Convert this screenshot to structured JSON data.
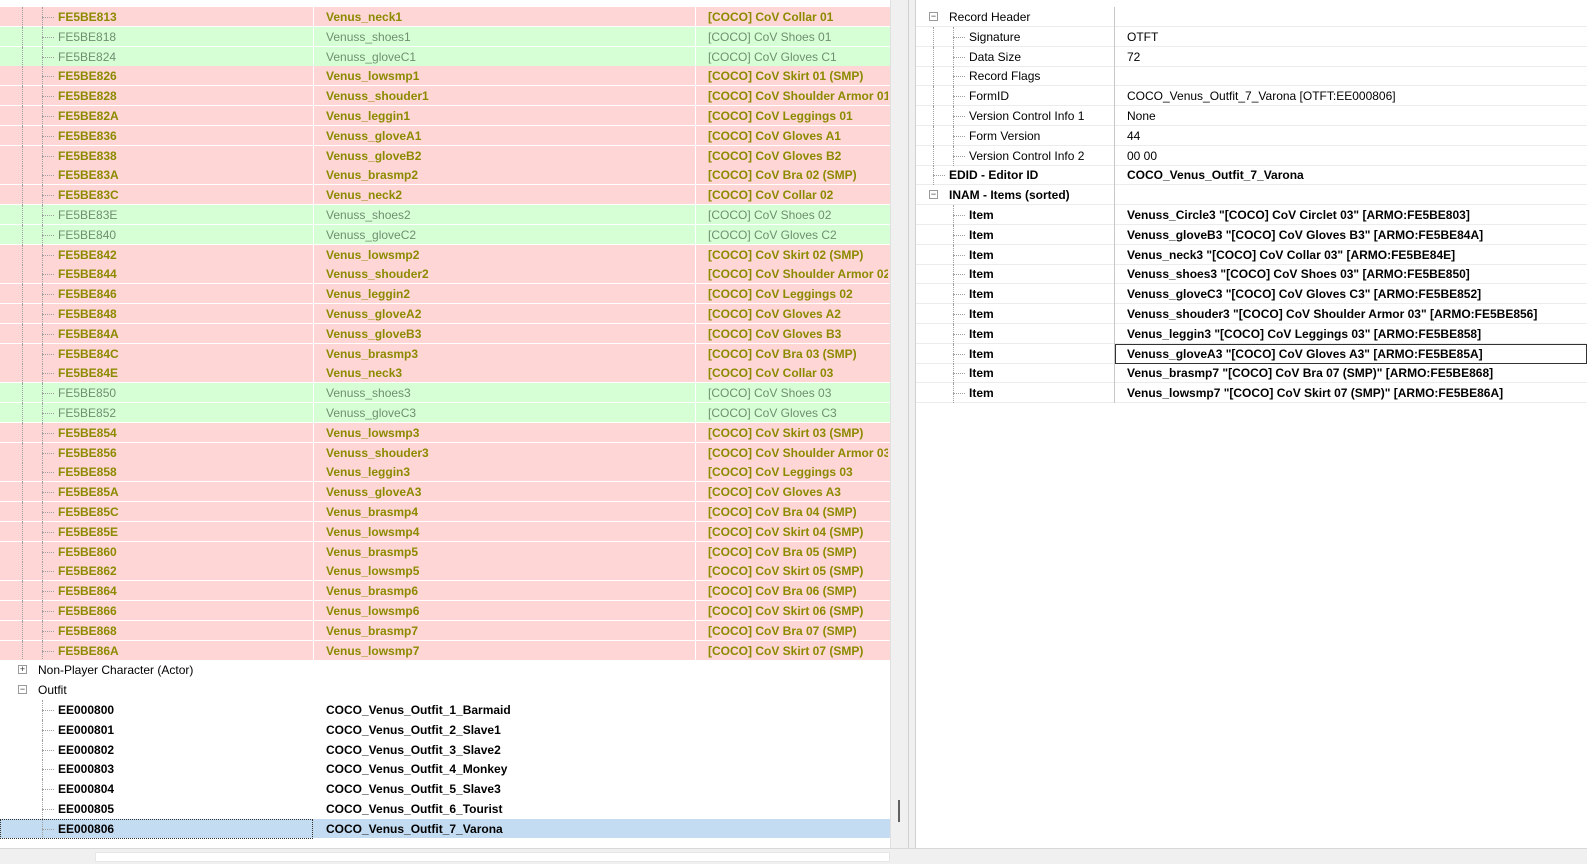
{
  "left_rows": [
    {
      "formid": "FE5BE813",
      "editor_id": "Venus_neck1",
      "name": "[COCO] CoV Collar 01",
      "color": "red"
    },
    {
      "formid": "FE5BE818",
      "editor_id": "Venuss_shoes1",
      "name": "[COCO] CoV Shoes 01",
      "color": "green"
    },
    {
      "formid": "FE5BE824",
      "editor_id": "Venuss_gloveC1",
      "name": "[COCO] CoV Gloves C1",
      "color": "green"
    },
    {
      "formid": "FE5BE826",
      "editor_id": "Venus_lowsmp1",
      "name": "[COCO] CoV Skirt 01 (SMP)",
      "color": "red"
    },
    {
      "formid": "FE5BE828",
      "editor_id": "Venuss_shouder1",
      "name": "[COCO] CoV Shoulder Armor 01",
      "color": "red"
    },
    {
      "formid": "FE5BE82A",
      "editor_id": "Venus_leggin1",
      "name": "[COCO] CoV Leggings 01",
      "color": "red"
    },
    {
      "formid": "FE5BE836",
      "editor_id": "Venuss_gloveA1",
      "name": "[COCO] CoV Gloves A1",
      "color": "red"
    },
    {
      "formid": "FE5BE838",
      "editor_id": "Venuss_gloveB2",
      "name": "[COCO] CoV Gloves B2",
      "color": "red"
    },
    {
      "formid": "FE5BE83A",
      "editor_id": "Venus_brasmp2",
      "name": "[COCO] CoV Bra 02 (SMP)",
      "color": "red"
    },
    {
      "formid": "FE5BE83C",
      "editor_id": "Venus_neck2",
      "name": "[COCO] CoV Collar 02",
      "color": "red"
    },
    {
      "formid": "FE5BE83E",
      "editor_id": "Venuss_shoes2",
      "name": "[COCO] CoV Shoes 02",
      "color": "green"
    },
    {
      "formid": "FE5BE840",
      "editor_id": "Venuss_gloveC2",
      "name": "[COCO] CoV Gloves C2",
      "color": "green"
    },
    {
      "formid": "FE5BE842",
      "editor_id": "Venus_lowsmp2",
      "name": "[COCO] CoV Skirt 02 (SMP)",
      "color": "red"
    },
    {
      "formid": "FE5BE844",
      "editor_id": "Venuss_shouder2",
      "name": "[COCO] CoV Shoulder Armor 02",
      "color": "red"
    },
    {
      "formid": "FE5BE846",
      "editor_id": "Venus_leggin2",
      "name": "[COCO] CoV Leggings 02",
      "color": "red"
    },
    {
      "formid": "FE5BE848",
      "editor_id": "Venuss_gloveA2",
      "name": "[COCO] CoV Gloves A2",
      "color": "red"
    },
    {
      "formid": "FE5BE84A",
      "editor_id": "Venuss_gloveB3",
      "name": "[COCO] CoV Gloves B3",
      "color": "red"
    },
    {
      "formid": "FE5BE84C",
      "editor_id": "Venus_brasmp3",
      "name": "[COCO] CoV Bra 03 (SMP)",
      "color": "red"
    },
    {
      "formid": "FE5BE84E",
      "editor_id": "Venus_neck3",
      "name": "[COCO] CoV Collar 03",
      "color": "red"
    },
    {
      "formid": "FE5BE850",
      "editor_id": "Venuss_shoes3",
      "name": "[COCO] CoV Shoes 03",
      "color": "green"
    },
    {
      "formid": "FE5BE852",
      "editor_id": "Venuss_gloveC3",
      "name": "[COCO] CoV Gloves C3",
      "color": "green"
    },
    {
      "formid": "FE5BE854",
      "editor_id": "Venus_lowsmp3",
      "name": "[COCO] CoV Skirt 03 (SMP)",
      "color": "red"
    },
    {
      "formid": "FE5BE856",
      "editor_id": "Venuss_shouder3",
      "name": "[COCO] CoV Shoulder Armor 03",
      "color": "red"
    },
    {
      "formid": "FE5BE858",
      "editor_id": "Venus_leggin3",
      "name": "[COCO] CoV Leggings 03",
      "color": "red"
    },
    {
      "formid": "FE5BE85A",
      "editor_id": "Venuss_gloveA3",
      "name": "[COCO] CoV Gloves A3",
      "color": "red"
    },
    {
      "formid": "FE5BE85C",
      "editor_id": "Venus_brasmp4",
      "name": "[COCO] CoV Bra 04 (SMP)",
      "color": "red"
    },
    {
      "formid": "FE5BE85E",
      "editor_id": "Venus_lowsmp4",
      "name": "[COCO] CoV Skirt 04 (SMP)",
      "color": "red"
    },
    {
      "formid": "FE5BE860",
      "editor_id": "Venus_brasmp5",
      "name": "[COCO] CoV Bra 05 (SMP)",
      "color": "red"
    },
    {
      "formid": "FE5BE862",
      "editor_id": "Venus_lowsmp5",
      "name": "[COCO] CoV Skirt 05 (SMP)",
      "color": "red"
    },
    {
      "formid": "FE5BE864",
      "editor_id": "Venus_brasmp6",
      "name": "[COCO] CoV Bra 06 (SMP)",
      "color": "red"
    },
    {
      "formid": "FE5BE866",
      "editor_id": "Venus_lowsmp6",
      "name": "[COCO] CoV Skirt 06 (SMP)",
      "color": "red"
    },
    {
      "formid": "FE5BE868",
      "editor_id": "Venus_brasmp7",
      "name": "[COCO] CoV Bra 07 (SMP)",
      "color": "red"
    },
    {
      "formid": "FE5BE86A",
      "editor_id": "Venus_lowsmp7",
      "name": "[COCO] CoV Skirt 07 (SMP)",
      "color": "red"
    }
  ],
  "groups": {
    "npc": {
      "label": "Non-Player Character (Actor)",
      "expander": "+"
    },
    "outfit": {
      "label": "Outfit",
      "expander": "−"
    }
  },
  "outfit_rows": [
    {
      "formid": "EE000800",
      "editor_id": "COCO_Venus_Outfit_1_Barmaid"
    },
    {
      "formid": "EE000801",
      "editor_id": "COCO_Venus_Outfit_2_Slave1"
    },
    {
      "formid": "EE000802",
      "editor_id": "COCO_Venus_Outfit_3_Slave2"
    },
    {
      "formid": "EE000803",
      "editor_id": "COCO_Venus_Outfit_4_Monkey"
    },
    {
      "formid": "EE000804",
      "editor_id": "COCO_Venus_Outfit_5_Slave3"
    },
    {
      "formid": "EE000805",
      "editor_id": "COCO_Venus_Outfit_6_Tourist"
    },
    {
      "formid": "EE000806",
      "editor_id": "COCO_Venus_Outfit_7_Varona",
      "selected": true
    }
  ],
  "record": {
    "header": {
      "label": "Record Header",
      "fields": [
        {
          "name": "Signature",
          "value": "OTFT"
        },
        {
          "name": "Data Size",
          "value": "72"
        },
        {
          "name": "Record Flags",
          "value": ""
        },
        {
          "name": "FormID",
          "value": "COCO_Venus_Outfit_7_Varona [OTFT:EE000806]"
        },
        {
          "name": "Version Control Info 1",
          "value": "None"
        },
        {
          "name": "Form Version",
          "value": "44"
        },
        {
          "name": "Version Control Info 2",
          "value": "00 00"
        }
      ]
    },
    "edid": {
      "name": "EDID - Editor ID",
      "value": "COCO_Venus_Outfit_7_Varona"
    },
    "inam": {
      "label": "INAM - Items (sorted)",
      "items": [
        {
          "name": "Item",
          "value": "Venuss_Circle3 \"[COCO] CoV Circlet 03\" [ARMO:FE5BE803]"
        },
        {
          "name": "Item",
          "value": "Venuss_gloveB3 \"[COCO] CoV Gloves B3\" [ARMO:FE5BE84A]"
        },
        {
          "name": "Item",
          "value": "Venus_neck3 \"[COCO] CoV Collar 03\" [ARMO:FE5BE84E]"
        },
        {
          "name": "Item",
          "value": "Venuss_shoes3 \"[COCO] CoV Shoes 03\" [ARMO:FE5BE850]"
        },
        {
          "name": "Item",
          "value": "Venuss_gloveC3 \"[COCO] CoV Gloves C3\" [ARMO:FE5BE852]"
        },
        {
          "name": "Item",
          "value": "Venuss_shouder3 \"[COCO] CoV Shoulder Armor 03\" [ARMO:FE5BE856]"
        },
        {
          "name": "Item",
          "value": "Venus_leggin3 \"[COCO] CoV Leggings 03\" [ARMO:FE5BE858]"
        },
        {
          "name": "Item",
          "value": "Venuss_gloveA3 \"[COCO] CoV Gloves A3\" [ARMO:FE5BE85A]",
          "focused": true
        },
        {
          "name": "Item",
          "value": "Venus_brasmp7 \"[COCO] CoV Bra 07 (SMP)\" [ARMO:FE5BE868]"
        },
        {
          "name": "Item",
          "value": "Venus_lowsmp7 \"[COCO] CoV Skirt 07 (SMP)\" [ARMO:FE5BE86A]"
        }
      ]
    }
  },
  "colors": {
    "conflict_red": "#ffd6d6",
    "override_green": "#d6ffd6",
    "selected_blue": "#c4dcf2"
  }
}
